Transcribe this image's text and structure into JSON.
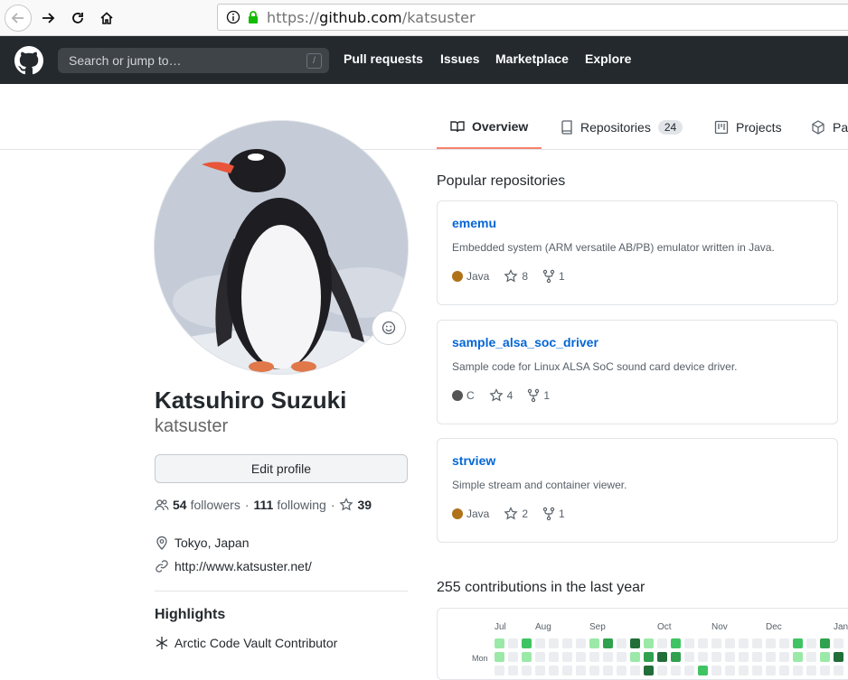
{
  "browser": {
    "url_scheme": "https://",
    "url_host": "github.com",
    "url_path": "/katsuster"
  },
  "header": {
    "search_placeholder": "Search or jump to…",
    "search_shortcut": "/",
    "nav": [
      "Pull requests",
      "Issues",
      "Marketplace",
      "Explore"
    ]
  },
  "tabs": [
    {
      "label": "Overview",
      "icon": "book-icon",
      "selected": true
    },
    {
      "label": "Repositories",
      "icon": "repo-icon",
      "count": "24"
    },
    {
      "label": "Projects",
      "icon": "project-icon"
    },
    {
      "label": "Pa",
      "icon": "package-icon"
    }
  ],
  "profile": {
    "fullname": "Katsuhiro Suzuki",
    "username": "katsuster",
    "edit_label": "Edit profile",
    "followers_count": "54",
    "followers_label": "followers",
    "following_count": "111",
    "following_label": "following",
    "stars_count": "39",
    "location": "Tokyo, Japan",
    "website": "http://www.katsuster.net/",
    "highlights_title": "Highlights",
    "highlight_item": "Arctic Code Vault Contributor"
  },
  "repos": {
    "title": "Popular repositories",
    "items": [
      {
        "name": "ememu",
        "desc": "Embedded system (ARM versatile AB/PB) emulator written in Java.",
        "lang": "Java",
        "lang_color": "#b07219",
        "stars": "8",
        "forks": "1"
      },
      {
        "name": "sample_alsa_soc_driver",
        "desc": "Sample code for Linux ALSA SoC sound card device driver.",
        "lang": "C",
        "lang_color": "#555555",
        "stars": "4",
        "forks": "1"
      },
      {
        "name": "strview",
        "desc": "Simple stream and container viewer.",
        "lang": "Java",
        "lang_color": "#b07219",
        "stars": "2",
        "forks": "1"
      }
    ]
  },
  "contributions": {
    "title": "255 contributions in the last year",
    "months": [
      "Jul",
      "Aug",
      "Sep",
      "Oct",
      "Nov",
      "Dec",
      "Jan"
    ],
    "day_label": "Mon",
    "colors": [
      "#ebedf0",
      "#9be9a8",
      "#40c463",
      "#30a14e",
      "#216e39"
    ]
  },
  "colors": {
    "header_bg": "#24292e",
    "link": "#0366d6",
    "tab_underline": "#f9826c"
  }
}
